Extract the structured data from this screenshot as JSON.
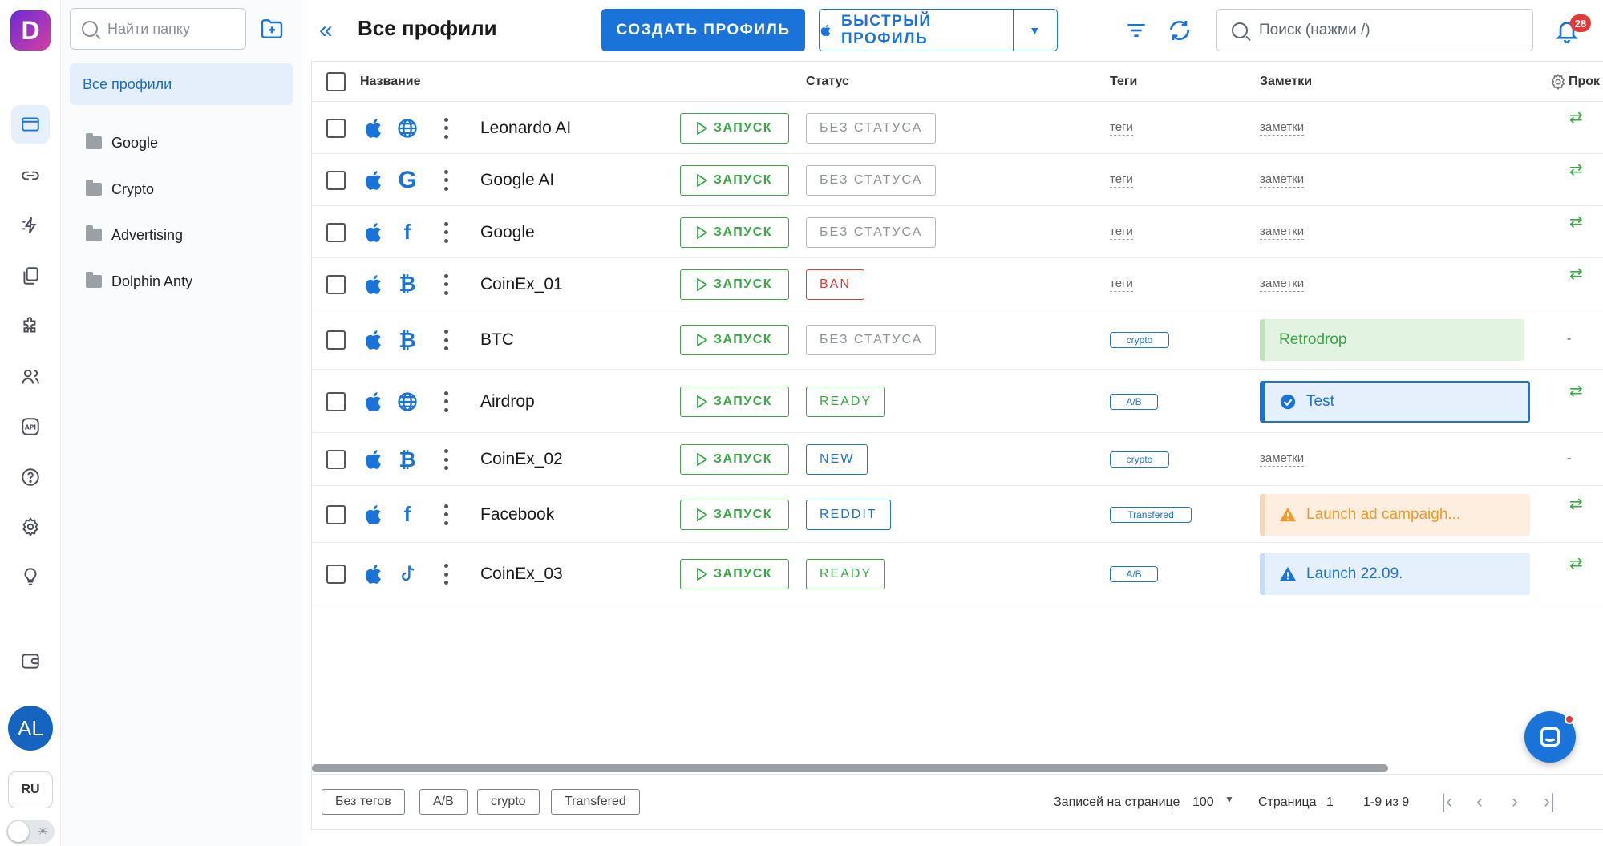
{
  "app": {
    "logo_letter": "D",
    "brand_color": "#1a73d9"
  },
  "rail": {
    "avatar_initials": "AL",
    "language": "RU",
    "items": [
      "profiles-icon",
      "link-icon",
      "automation-icon",
      "copy-icon",
      "extensions-icon",
      "users-icon",
      "api-icon",
      "help-icon",
      "settings-icon",
      "idea-icon",
      "wallet-icon"
    ]
  },
  "folders": {
    "search_placeholder": "Найти папку",
    "all_label": "Все профили",
    "items": [
      {
        "label": "Google"
      },
      {
        "label": "Crypto"
      },
      {
        "label": "Advertising"
      },
      {
        "label": "Dolphin Anty"
      }
    ]
  },
  "toolbar": {
    "title": "Все профили",
    "create_label": "СОЗДАТЬ ПРОФИЛЬ",
    "quick_label": "БЫСТРЫЙ ПРОФИЛЬ",
    "search_placeholder": "Поиск (нажми /)",
    "notifications_count": "28"
  },
  "table": {
    "headers": {
      "name": "Название",
      "status": "Статус",
      "tags": "Теги",
      "notes": "Заметки",
      "extra": "Прок"
    },
    "launch_label": "ЗАПУСК",
    "tags_placeholder": "теги",
    "notes_placeholder": "заметки",
    "rows": [
      {
        "name": "Leonardo AI",
        "site_icon": "globe-icon",
        "status": "БЕЗ СТАТУСА",
        "status_type": "none",
        "tag": "",
        "note": "",
        "note_type": "placeholder",
        "proxy": "swap"
      },
      {
        "name": "Google AI",
        "site_icon": "google-icon",
        "status": "БЕЗ СТАТУСА",
        "status_type": "none",
        "tag": "",
        "note": "",
        "note_type": "placeholder",
        "proxy": "swap"
      },
      {
        "name": "Google",
        "site_icon": "facebook-icon",
        "status": "БЕЗ СТАТУСА",
        "status_type": "none",
        "tag": "",
        "note": "",
        "note_type": "placeholder",
        "proxy": "swap"
      },
      {
        "name": "CoinEx_01",
        "site_icon": "bitcoin-icon",
        "status": "BAN",
        "status_type": "ban",
        "tag": "",
        "note": "",
        "note_type": "placeholder",
        "proxy": "swap"
      },
      {
        "name": "BTC",
        "site_icon": "bitcoin-icon",
        "status": "БЕЗ СТАТУСА",
        "status_type": "none",
        "tag": "crypto",
        "note": "Retrodrop",
        "note_type": "green",
        "proxy": "-"
      },
      {
        "name": "Airdrop",
        "site_icon": "globe-icon",
        "status": "READY",
        "status_type": "ready",
        "tag": "A/B",
        "note": "Test",
        "note_type": "blue-selected",
        "proxy": "swap"
      },
      {
        "name": "CoinEx_02",
        "site_icon": "bitcoin-icon",
        "status": "NEW",
        "status_type": "new",
        "tag": "crypto",
        "note": "",
        "note_type": "placeholder",
        "proxy": "-"
      },
      {
        "name": "Facebook",
        "site_icon": "facebook-icon",
        "status": "REDDIT",
        "status_type": "reddit",
        "tag": "Transfered",
        "note": "Launch ad campaigh...",
        "note_type": "orange",
        "proxy": "swap"
      },
      {
        "name": "CoinEx_03",
        "site_icon": "tiktok-icon",
        "status": "READY",
        "status_type": "ready",
        "tag": "A/B",
        "note": "Launch 22.09.",
        "note_type": "blue",
        "proxy": "swap"
      }
    ]
  },
  "footer": {
    "tag_filters": [
      "Без тегов",
      "A/B",
      "crypto",
      "Transfered"
    ],
    "per_page_label": "Записей на странице",
    "per_page_value": "100",
    "page_label": "Страница",
    "page_value": "1",
    "range_label": "1-9 из 9"
  }
}
